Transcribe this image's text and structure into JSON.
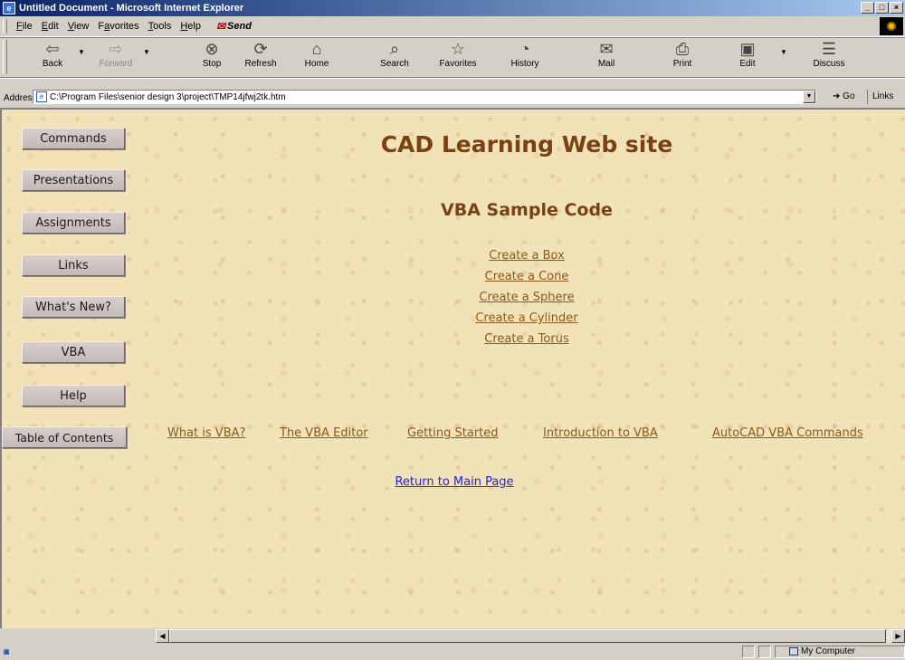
{
  "window": {
    "title": "Untitled Document - Microsoft Internet Explorer"
  },
  "menu": {
    "items": [
      {
        "key": "F",
        "rest": "ile"
      },
      {
        "key": "E",
        "rest": "dit"
      },
      {
        "key": "V",
        "rest": "iew"
      },
      {
        "pre": "F",
        "key": "a",
        "rest": "vorites"
      },
      {
        "key": "T",
        "rest": "ools"
      },
      {
        "key": "H",
        "rest": "elp"
      }
    ],
    "send_label": "Send"
  },
  "toolbar": {
    "back": "Back",
    "forward": "Forward",
    "stop": "Stop",
    "refresh": "Refresh",
    "home": "Home",
    "search": "Search",
    "favorites": "Favorites",
    "history": "History",
    "mail": "Mail",
    "print": "Print",
    "edit": "Edit",
    "discuss": "Discuss"
  },
  "address": {
    "label": "Address",
    "value": "C:\\Program Files\\senior design 3\\project\\TMP14jfwj2tk.htm",
    "go": "Go",
    "links": "Links"
  },
  "sidebar": {
    "items": [
      "Commands",
      "Presentations",
      "Assignments",
      "Links",
      "What's New?",
      "VBA",
      "Help",
      "Table of Contents"
    ]
  },
  "main": {
    "site_title": "CAD Learning Web site",
    "section_title": "VBA Sample Code",
    "samples": [
      "Create a Box",
      "Create a Cone",
      "Create a Sphere",
      "Create a Cylinder",
      "Create a Torus"
    ],
    "bottom_links": [
      "What is VBA?",
      "The VBA Editor",
      "Getting Started",
      "Introduction to VBA",
      "AutoCAD VBA Commands"
    ],
    "return_link": "Return to Main Page"
  },
  "status": {
    "zone": "My Computer"
  },
  "colors": {
    "background": "#f1e2b8",
    "heading": "#7a4212",
    "link": "#8d5a1a",
    "return_link": "#2525d6"
  }
}
